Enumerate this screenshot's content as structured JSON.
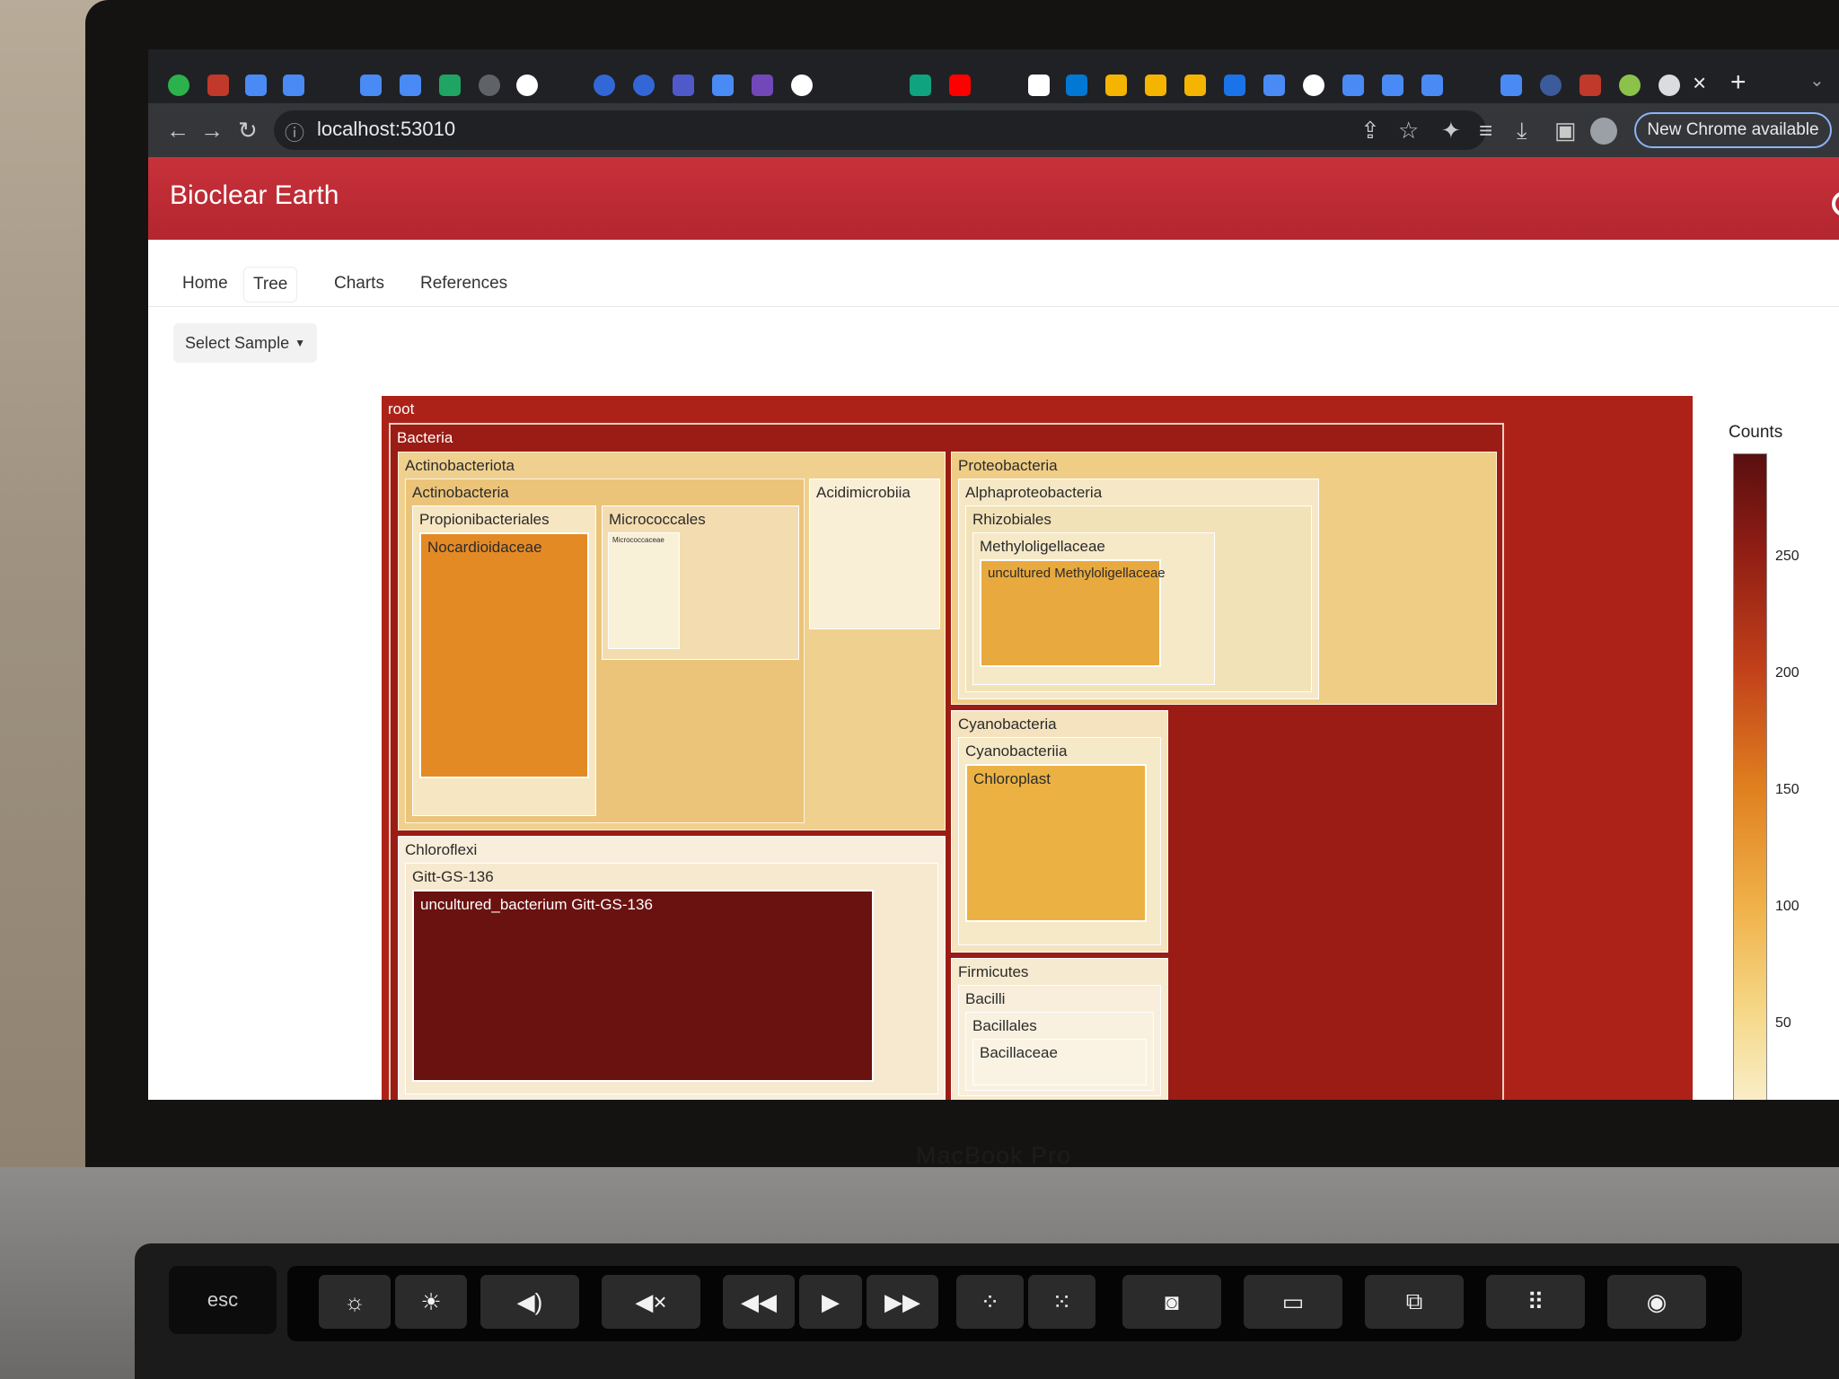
{
  "browser": {
    "url": "localhost:53010",
    "update_button": "New Chrome available"
  },
  "app": {
    "brand": "Bioclear Earth",
    "menu": [
      "Home",
      "Tree",
      "Charts",
      "References"
    ],
    "select_sample": "Select Sample"
  },
  "treemap": {
    "nodes": {
      "root": "root",
      "bacteria": "Bacteria",
      "actinobacteriota": "Actinobacteriota",
      "actinobacteria": "Actinobacteria",
      "propionibacteriales": "Propionibacteriales",
      "nocardioidaceae": "Nocardioidaceae",
      "micrococcales": "Micrococcales",
      "micrococcaceae": "Micrococcaceae",
      "acidimicrobiia": "Acidimicrobiia",
      "proteobacteria": "Proteobacteria",
      "alphaproteobacteria": "Alphaproteobacteria",
      "rhizobiales": "Rhizobiales",
      "methyloligellaceae": "Methyloligellaceae",
      "uncultured_methyloligellaceae": "uncultured Methyloligellaceae",
      "cyanobacteria": "Cyanobacteria",
      "cyanobacteriia": "Cyanobacteriia",
      "chloroplast": "Chloroplast",
      "chloroflexi": "Chloroflexi",
      "gitt": "Gitt-GS-136",
      "uncultured_gitt": "uncultured_bacterium Gitt-GS-136",
      "firmicutes": "Firmicutes",
      "bacilli": "Bacilli",
      "bacillales": "Bacillales",
      "bacillaceae": "Bacillaceae"
    }
  },
  "colorbar": {
    "title": "Counts",
    "ticks": [
      "250",
      "200",
      "150",
      "100",
      "50"
    ]
  },
  "laptop_label": "MacBook Pro",
  "keys": {
    "esc": "esc"
  }
}
